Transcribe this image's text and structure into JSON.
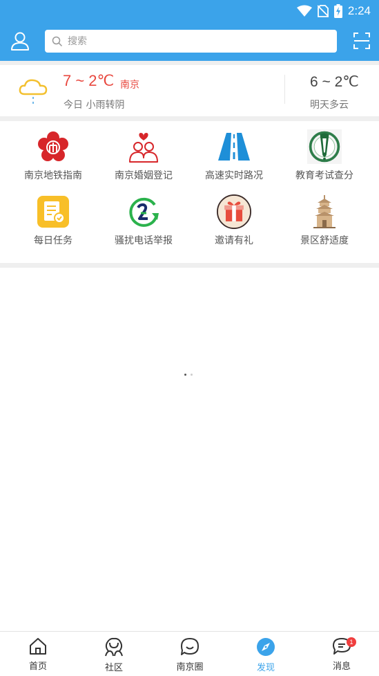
{
  "status": {
    "time": "2:24"
  },
  "header": {
    "search_placeholder": "搜索"
  },
  "weather": {
    "today_temp": "7 ~ 2℃",
    "city": "南京",
    "today_desc": "今日 小雨转阴",
    "tomorrow_temp": "6 ~ 2℃",
    "tomorrow_desc": "明天多云"
  },
  "services": [
    {
      "label": "南京地铁指南",
      "icon": "metro-icon"
    },
    {
      "label": "南京婚姻登记",
      "icon": "marriage-icon"
    },
    {
      "label": "高速实时路况",
      "icon": "highway-icon"
    },
    {
      "label": "教育考试查分",
      "icon": "exam-icon"
    },
    {
      "label": "每日任务",
      "icon": "task-icon"
    },
    {
      "label": "骚扰电话举报",
      "icon": "phone-report-icon"
    },
    {
      "label": "邀请有礼",
      "icon": "gift-icon"
    },
    {
      "label": "景区舒适度",
      "icon": "pagoda-icon"
    }
  ],
  "pager": {
    "pages": 2,
    "current": 1
  },
  "tabs": [
    {
      "label": "首页",
      "icon": "home-icon"
    },
    {
      "label": "社区",
      "icon": "community-icon"
    },
    {
      "label": "南京圈",
      "icon": "chat-circle-icon"
    },
    {
      "label": "发现",
      "icon": "compass-icon",
      "active": true
    },
    {
      "label": "消息",
      "icon": "message-icon",
      "badge": "1"
    }
  ],
  "colors": {
    "primary": "#3ba3ea",
    "accent_red": "#e8473e"
  }
}
